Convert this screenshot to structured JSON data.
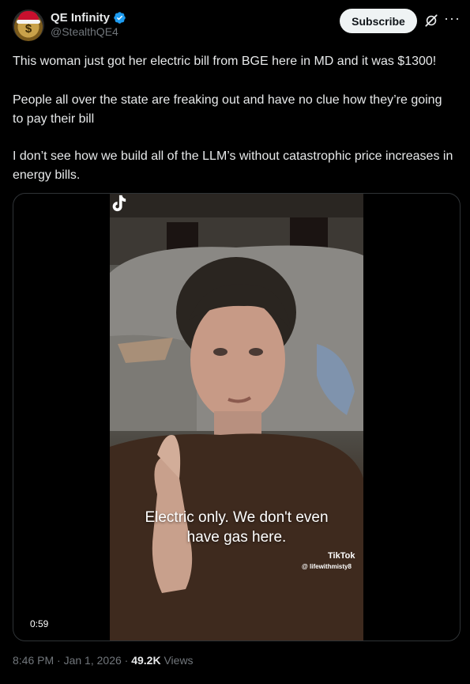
{
  "author": {
    "name": "QE Infinity",
    "handle": "@StealthQE4",
    "avatar_glyph": "$",
    "verified_icon": "verified-badge",
    "verified_color": "#1d9bf0"
  },
  "actions": {
    "subscribe_label": "Subscribe",
    "grok_icon": "grok-icon",
    "more_icon": "more-icon",
    "more_glyph": "···"
  },
  "tweet": {
    "paragraphs": [
      "This woman just got her electric bill from BGE here in MD and it was $1300!",
      "People all over the state are freaking out and have no clue how they’re going to pay their bill",
      "I don’t see how we build all of the LLM’s without catastrophic price increases in energy bills."
    ]
  },
  "video": {
    "caption_line1": "Electric only. We don't even",
    "caption_line2": "have gas here.",
    "watermark": "TikTok",
    "watermark_user": "@ lifewithmisty8",
    "duration": "0:59"
  },
  "meta": {
    "time": "8:46 PM",
    "separator": " · ",
    "date": "Jan 1, 2026",
    "views_count": "49.2K",
    "views_label": " Views"
  },
  "colors": {
    "background": "#000000",
    "text": "#e7e9ea",
    "muted": "#71767b",
    "border": "#2f3336"
  }
}
